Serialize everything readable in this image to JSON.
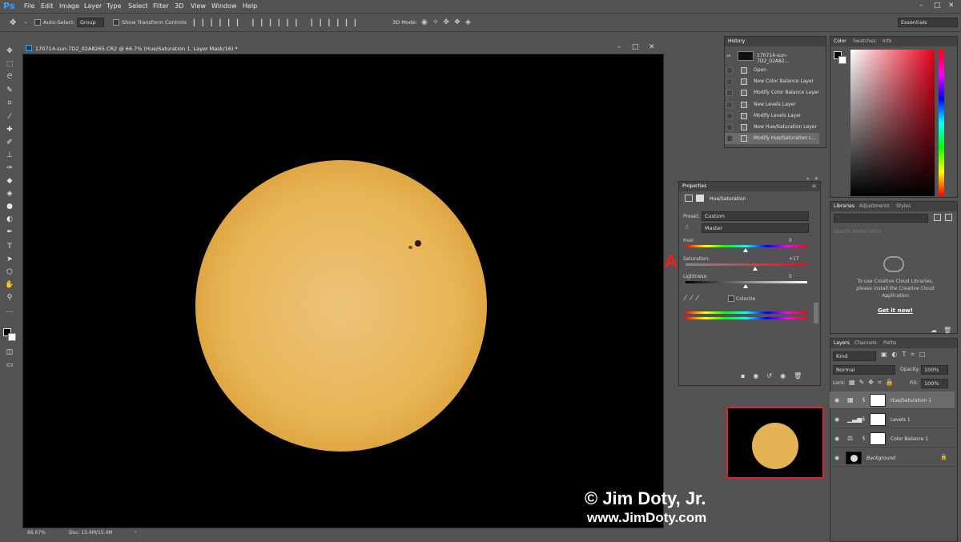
{
  "app": {
    "logo": "Ps"
  },
  "menu": [
    "File",
    "Edit",
    "Image",
    "Layer",
    "Type",
    "Select",
    "Filter",
    "3D",
    "View",
    "Window",
    "Help"
  ],
  "options": {
    "auto_select": "Auto-Select:",
    "group": "Group",
    "show_transform": "Show Transform Controls",
    "mode_3d": "3D Mode:",
    "workspace": "Essentials"
  },
  "document": {
    "title": "170714-sun-7D2_02A8265.CR2 @ 66.7% (Hue/Saturation 1, Layer Mask/16) *",
    "zoom": "66.67%",
    "doc_size": "Doc: 15.4M/15.4M"
  },
  "history": {
    "tab": "History",
    "snapshot": "170714-sun-7D2_02A82...",
    "items": [
      "Open",
      "New Color Balance Layer",
      "Modify Color Balance Layer",
      "New Levels Layer",
      "Modify Levels Layer",
      "New Hue/Saturation Layer",
      "Modify Hue/Saturation L..."
    ]
  },
  "color_panel": {
    "tabs": [
      "Color",
      "Swatches",
      "Info"
    ]
  },
  "libraries": {
    "tabs": [
      "Libraries",
      "Adjustments",
      "Styles"
    ],
    "search": "Search Adobe Stock",
    "message": "To use Creative Cloud Libraries, please install the Creative Cloud Application",
    "cta": "Get it now!"
  },
  "properties": {
    "tab": "Properties",
    "title": "Hue/Saturation",
    "preset_label": "Preset:",
    "preset_value": "Custom",
    "channel": "Master",
    "hue_label": "Hue:",
    "hue_value": "0",
    "sat_label": "Saturation:",
    "sat_value": "+17",
    "light_label": "Lightness:",
    "light_value": "0",
    "colorize": "Colorize"
  },
  "annotation": {
    "letter": "A"
  },
  "layers": {
    "tabs": [
      "Layers",
      "Channels",
      "Paths"
    ],
    "kind": "Kind",
    "blend": "Normal",
    "opacity_label": "Opacity:",
    "opacity_value": "100%",
    "lock_label": "Lock:",
    "fill_label": "Fill:",
    "fill_value": "100%",
    "rows": [
      {
        "name": "Hue/Saturation 1"
      },
      {
        "name": "Levels 1"
      },
      {
        "name": "Color Balance 1"
      },
      {
        "name": "Background"
      }
    ]
  },
  "watermark": {
    "line1": "© Jim Doty, Jr.",
    "line2": "www.JimDoty.com"
  },
  "colors": {
    "sun": "#e8b556",
    "accent_red": "#ff1a1a"
  }
}
